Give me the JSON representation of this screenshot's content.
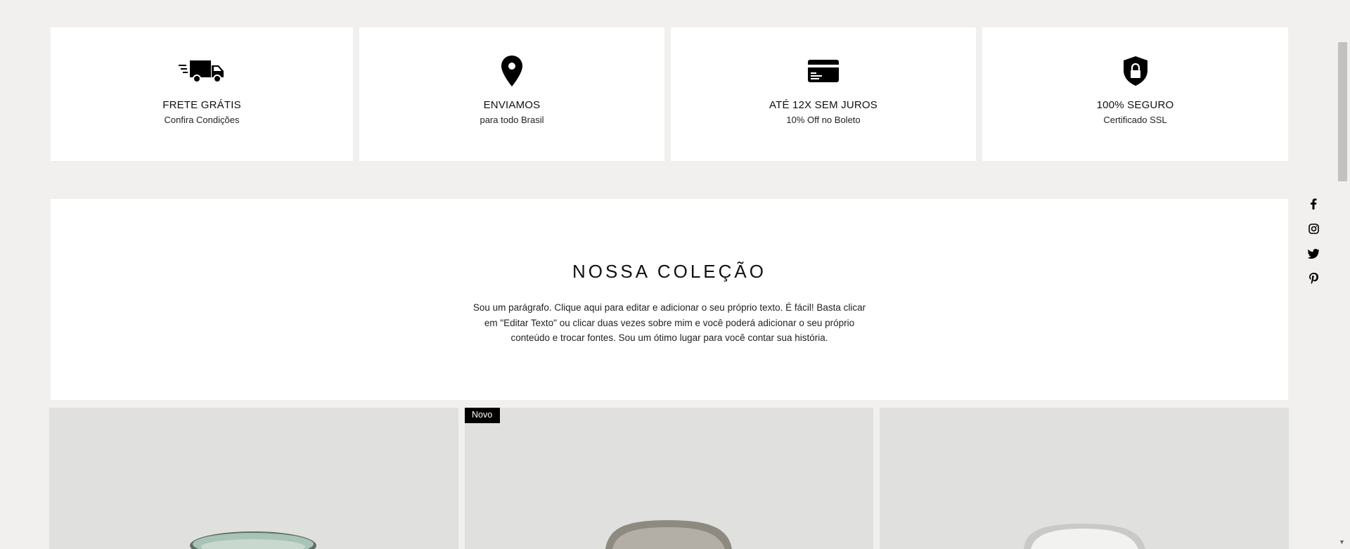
{
  "features": [
    {
      "icon": "truck-icon",
      "title": "FRETE GRÁTIS",
      "subtitle": "Confira Condições"
    },
    {
      "icon": "map-pin-icon",
      "title": "ENVIAMOS",
      "subtitle": "para todo Brasil"
    },
    {
      "icon": "credit-card-icon",
      "title": "ATÉ 12X SEM JUROS",
      "subtitle": "10% Off no Boleto"
    },
    {
      "icon": "shield-lock-icon",
      "title": "100% SEGURO",
      "subtitle": "Certificado SSL"
    }
  ],
  "collection": {
    "heading": "NOSSA COLEÇÃO",
    "paragraph": "Sou um parágrafo. Clique aqui para editar e adicionar o seu próprio texto. É fácil! Basta clicar em \"Editar Texto\" ou clicar duas vezes sobre mim e você poderá adicionar o seu próprio conteúdo e trocar fontes. Sou um ótimo lugar para você contar sua história."
  },
  "products": [
    {
      "badge": "",
      "bowl_color": "#a9c4b6"
    },
    {
      "badge": "Novo",
      "bowl_color": "#a39e93"
    },
    {
      "badge": "",
      "bowl_color": "#e9e9e8"
    }
  ],
  "social": [
    "facebook-icon",
    "instagram-icon",
    "twitter-icon",
    "pinterest-icon"
  ]
}
